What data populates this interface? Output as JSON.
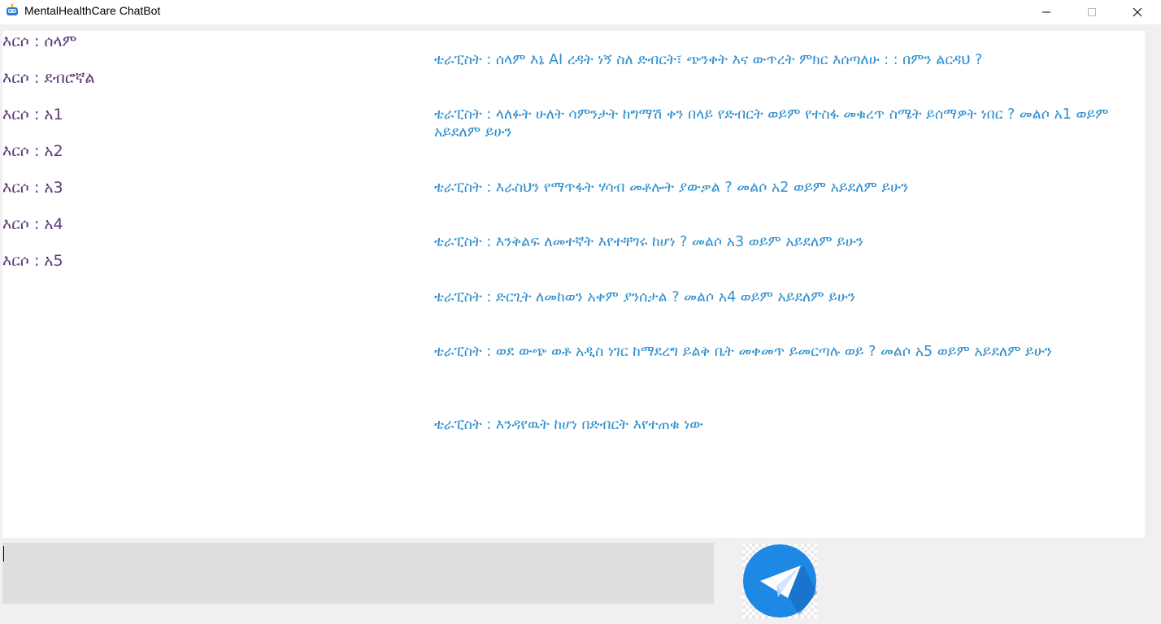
{
  "window": {
    "title": "MentalHealthCare ChatBot",
    "icons": {
      "app": "chatbot-app-icon",
      "minimize": "minimize-icon",
      "maximize": "maximize-icon",
      "close": "close-icon"
    }
  },
  "chat": {
    "user_messages": [
      "እርሶ :  ሰላም",
      "እርሶ :  ደብሮኛል",
      "እርሶ :  አ1",
      "እርሶ :  አ2",
      "እርሶ :  አ3",
      "እርሶ :  አ4",
      "እርሶ :  አ5"
    ],
    "bot_messages": [
      "ቴራፒስት :    ሰላም እኔ  AI ረዳት ነኝ ስለ ድብርት፣ ጭንቀት እና ውጥረት ምክር እሰጣለሁ :  : በምን ልርዳህ ?",
      "ቴራፒስት :  ላለፉት ሁለት ሳምንታት ከግማሽ ቀን በላይ የድብርት ወይም የተስፋ መቁረጥ ስሜት ይሰማዎት ነበር ?  መልሶ አ1 ወይም አይደለም ይሁን",
      "ቴራፒስት :  እራስህን የማጥፋት ሃሳብ መቶሎት ያውቃል ?  መልሶ አ2 ወይም አይደለም ይሁን",
      "ቴራፒስት :  እንቅልፍ ለመተኛት እየተቸገሩ ከሆነ ?  መልሶ አ3 ወይም አይደለም ይሁን",
      "ቴራፒስት :  ድርጊት ለመከወን አቀም ያንሰታል ?  መልሶ አ4 ወይም አይደለም ይሁን",
      "ቴራፒስት :    ወደ ውጭ ወቶ አዲስ ነገር ከማደረግ ይልቅ ቤት መቀመጥ ይመርጣሉ ወይ ? መልሶ አ5 ወይም አይደለም ይሁን",
      "ቴራፒስት :  እንዳየዉት ከሆነ በድብርት እየተጠቁ ነው"
    ]
  },
  "input": {
    "value": ""
  },
  "send_button": {
    "icon": "paper-plane-icon"
  },
  "colors": {
    "user_text": "#5b3a7a",
    "bot_text": "#2f8fce",
    "send_button": "#1e88e5"
  }
}
